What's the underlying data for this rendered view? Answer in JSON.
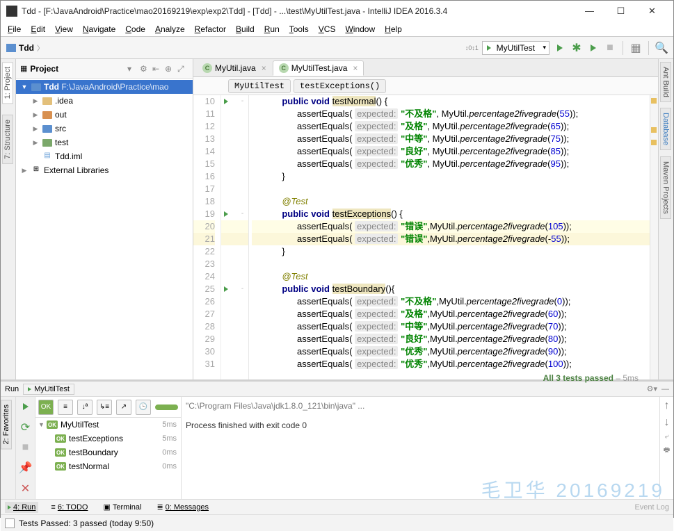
{
  "window": {
    "title": "Tdd - [F:\\JavaAndroid\\Practice\\mao20169219\\exp\\exp2\\Tdd] - [Tdd] - ...\\test\\MyUtilTest.java - IntelliJ IDEA 2016.3.4"
  },
  "menu": {
    "items": [
      "File",
      "Edit",
      "View",
      "Navigate",
      "Code",
      "Analyze",
      "Refactor",
      "Build",
      "Run",
      "Tools",
      "VCS",
      "Window",
      "Help"
    ]
  },
  "toolbar": {
    "breadcrumb": "Tdd",
    "run_config": "MyUtilTest"
  },
  "left_tabs": {
    "project": "1: Project",
    "structure": "7: Structure"
  },
  "right_tabs": {
    "ant": "Ant Build",
    "db": "Database",
    "maven": "Maven Projects"
  },
  "project": {
    "title": "Project",
    "root": {
      "name": "Tdd",
      "path": "F:\\JavaAndroid\\Practice\\mao"
    },
    "children": [
      {
        "name": ".idea",
        "color": ""
      },
      {
        "name": "out",
        "color": "orange"
      },
      {
        "name": "src",
        "color": "blue"
      },
      {
        "name": "test",
        "color": "green"
      },
      {
        "name": "Tdd.iml",
        "file": true
      }
    ],
    "ext_libs": "External Libraries"
  },
  "tabs": [
    {
      "label": "MyUtil.java",
      "active": false
    },
    {
      "label": "MyUtilTest.java",
      "active": true
    }
  ],
  "crumbs": {
    "class": "MyUtilTest",
    "method": "testExceptions()"
  },
  "code_lines": [
    {
      "n": 10,
      "run": true,
      "fold": "-",
      "ind": 2,
      "tok": [
        [
          "kw",
          "public"
        ],
        [
          "sp",
          " "
        ],
        [
          "kw",
          "void"
        ],
        [
          "sp",
          " "
        ],
        [
          "mname",
          "testNormal"
        ],
        [
          "p",
          "() {"
        ]
      ]
    },
    {
      "n": 11,
      "ind": 3,
      "tok": [
        [
          "id",
          "assertEquals"
        ],
        [
          "p",
          "( "
        ],
        [
          "hint",
          "expected:"
        ],
        [
          "sp",
          " "
        ],
        [
          "str",
          "\"不及格\""
        ],
        [
          "p",
          ", MyUtil."
        ],
        [
          "meth",
          "percentage2fivegrade"
        ],
        [
          "p",
          "("
        ],
        [
          "num",
          "55"
        ],
        [
          "p",
          "));"
        ]
      ]
    },
    {
      "n": 12,
      "ind": 3,
      "tok": [
        [
          "id",
          "assertEquals"
        ],
        [
          "p",
          "( "
        ],
        [
          "hint",
          "expected:"
        ],
        [
          "sp",
          " "
        ],
        [
          "str",
          "\"及格\""
        ],
        [
          "p",
          ", MyUtil."
        ],
        [
          "meth",
          "percentage2fivegrade"
        ],
        [
          "p",
          "("
        ],
        [
          "num",
          "65"
        ],
        [
          "p",
          "));"
        ]
      ]
    },
    {
      "n": 13,
      "ind": 3,
      "tok": [
        [
          "id",
          "assertEquals"
        ],
        [
          "p",
          "( "
        ],
        [
          "hint",
          "expected:"
        ],
        [
          "sp",
          " "
        ],
        [
          "str",
          "\"中等\""
        ],
        [
          "p",
          ", MyUtil."
        ],
        [
          "meth",
          "percentage2fivegrade"
        ],
        [
          "p",
          "("
        ],
        [
          "num",
          "75"
        ],
        [
          "p",
          "));"
        ]
      ]
    },
    {
      "n": 14,
      "ind": 3,
      "tok": [
        [
          "id",
          "assertEquals"
        ],
        [
          "p",
          "( "
        ],
        [
          "hint",
          "expected:"
        ],
        [
          "sp",
          " "
        ],
        [
          "str",
          "\"良好\""
        ],
        [
          "p",
          ", MyUtil."
        ],
        [
          "meth",
          "percentage2fivegrade"
        ],
        [
          "p",
          "("
        ],
        [
          "num",
          "85"
        ],
        [
          "p",
          "));"
        ]
      ]
    },
    {
      "n": 15,
      "ind": 3,
      "tok": [
        [
          "id",
          "assertEquals"
        ],
        [
          "p",
          "( "
        ],
        [
          "hint",
          "expected:"
        ],
        [
          "sp",
          " "
        ],
        [
          "str",
          "\"优秀\""
        ],
        [
          "p",
          ", MyUtil."
        ],
        [
          "meth",
          "percentage2fivegrade"
        ],
        [
          "p",
          "("
        ],
        [
          "num",
          "95"
        ],
        [
          "p",
          "));"
        ]
      ]
    },
    {
      "n": 16,
      "ind": 2,
      "tok": [
        [
          "p",
          "}"
        ]
      ]
    },
    {
      "n": 17,
      "ind": 0,
      "tok": []
    },
    {
      "n": 18,
      "ind": 2,
      "tok": [
        [
          "ann",
          "@Test"
        ]
      ]
    },
    {
      "n": 19,
      "run": true,
      "fold": "-",
      "ind": 2,
      "tok": [
        [
          "kw",
          "public"
        ],
        [
          "sp",
          " "
        ],
        [
          "kw",
          "void"
        ],
        [
          "sp",
          " "
        ],
        [
          "mname",
          "testExceptions"
        ],
        [
          "p",
          "() {"
        ]
      ]
    },
    {
      "n": 20,
      "hl": true,
      "ind": 3,
      "tok": [
        [
          "id",
          "assertEquals"
        ],
        [
          "p",
          "( "
        ],
        [
          "hint",
          "expected:"
        ],
        [
          "sp",
          " "
        ],
        [
          "str",
          "\"错误\""
        ],
        [
          "p",
          ",MyUtil."
        ],
        [
          "meth",
          "percentage2fivegrade"
        ],
        [
          "p",
          "("
        ],
        [
          "num",
          "105"
        ],
        [
          "p",
          "));"
        ]
      ]
    },
    {
      "n": 21,
      "sel": true,
      "ind": 3,
      "tok": [
        [
          "id",
          "assertEquals"
        ],
        [
          "p",
          "( "
        ],
        [
          "hint",
          "expected:"
        ],
        [
          "sp",
          " "
        ],
        [
          "str",
          "\"错误\""
        ],
        [
          "p",
          ",MyUtil."
        ],
        [
          "meth",
          "percentage2fivegrade"
        ],
        [
          "p",
          "(-"
        ],
        [
          "num",
          "55"
        ],
        [
          "p",
          "));"
        ]
      ]
    },
    {
      "n": 22,
      "ind": 2,
      "tok": [
        [
          "p",
          "}"
        ]
      ]
    },
    {
      "n": 23,
      "ind": 0,
      "tok": []
    },
    {
      "n": 24,
      "ind": 2,
      "tok": [
        [
          "ann",
          "@Test"
        ]
      ]
    },
    {
      "n": 25,
      "run": true,
      "fold": "-",
      "ind": 2,
      "tok": [
        [
          "kw",
          "public"
        ],
        [
          "sp",
          " "
        ],
        [
          "kw",
          "void"
        ],
        [
          "sp",
          " "
        ],
        [
          "mname",
          "testBoundary"
        ],
        [
          "p",
          "(){"
        ]
      ]
    },
    {
      "n": 26,
      "ind": 3,
      "tok": [
        [
          "id",
          "assertEquals"
        ],
        [
          "p",
          "( "
        ],
        [
          "hint",
          "expected:"
        ],
        [
          "sp",
          " "
        ],
        [
          "str",
          "\"不及格\""
        ],
        [
          "p",
          ",MyUtil."
        ],
        [
          "meth",
          "percentage2fivegrade"
        ],
        [
          "p",
          "("
        ],
        [
          "num",
          "0"
        ],
        [
          "p",
          "));"
        ]
      ]
    },
    {
      "n": 27,
      "ind": 3,
      "tok": [
        [
          "id",
          "assertEquals"
        ],
        [
          "p",
          "( "
        ],
        [
          "hint",
          "expected:"
        ],
        [
          "sp",
          " "
        ],
        [
          "str",
          "\"及格\""
        ],
        [
          "p",
          ",MyUtil."
        ],
        [
          "meth",
          "percentage2fivegrade"
        ],
        [
          "p",
          "("
        ],
        [
          "num",
          "60"
        ],
        [
          "p",
          "));"
        ]
      ]
    },
    {
      "n": 28,
      "ind": 3,
      "tok": [
        [
          "id",
          "assertEquals"
        ],
        [
          "p",
          "( "
        ],
        [
          "hint",
          "expected:"
        ],
        [
          "sp",
          " "
        ],
        [
          "str",
          "\"中等\""
        ],
        [
          "p",
          ",MyUtil."
        ],
        [
          "meth",
          "percentage2fivegrade"
        ],
        [
          "p",
          "("
        ],
        [
          "num",
          "70"
        ],
        [
          "p",
          "));"
        ]
      ]
    },
    {
      "n": 29,
      "ind": 3,
      "tok": [
        [
          "id",
          "assertEquals"
        ],
        [
          "p",
          "( "
        ],
        [
          "hint",
          "expected:"
        ],
        [
          "sp",
          " "
        ],
        [
          "str",
          "\"良好\""
        ],
        [
          "p",
          ",MyUtil."
        ],
        [
          "meth",
          "percentage2fivegrade"
        ],
        [
          "p",
          "("
        ],
        [
          "num",
          "80"
        ],
        [
          "p",
          "));"
        ]
      ]
    },
    {
      "n": 30,
      "ind": 3,
      "tok": [
        [
          "id",
          "assertEquals"
        ],
        [
          "p",
          "( "
        ],
        [
          "hint",
          "expected:"
        ],
        [
          "sp",
          " "
        ],
        [
          "str",
          "\"优秀\""
        ],
        [
          "p",
          ",MyUtil."
        ],
        [
          "meth",
          "percentage2fivegrade"
        ],
        [
          "p",
          "("
        ],
        [
          "num",
          "90"
        ],
        [
          "p",
          "));"
        ]
      ]
    },
    {
      "n": 31,
      "ind": 3,
      "tok": [
        [
          "id",
          "assertEquals"
        ],
        [
          "p",
          "( "
        ],
        [
          "hint",
          "expected:"
        ],
        [
          "sp",
          " "
        ],
        [
          "str",
          "\"优秀\""
        ],
        [
          "p",
          ",MyUtil."
        ],
        [
          "meth",
          "percentage2fivegrade"
        ],
        [
          "p",
          "("
        ],
        [
          "num",
          "100"
        ],
        [
          "p",
          "));"
        ]
      ]
    }
  ],
  "run": {
    "header_tab": "MyUtilTest",
    "header_label": "Run",
    "status": {
      "label": "All 3 tests passed",
      "time": "– 5ms"
    },
    "tree": {
      "root": {
        "name": "MyUtilTest",
        "time": "5ms"
      },
      "children": [
        {
          "name": "testExceptions",
          "time": "5ms"
        },
        {
          "name": "testBoundary",
          "time": "0ms"
        },
        {
          "name": "testNormal",
          "time": "0ms"
        }
      ]
    },
    "console": {
      "line1": "\"C:\\Program Files\\Java\\jdk1.8.0_121\\bin\\java\" ...",
      "line2": "Process finished with exit code 0"
    }
  },
  "bottom_tabs": {
    "run": "4: Run",
    "todo": "6: TODO",
    "terminal": "Terminal",
    "messages": "0: Messages"
  },
  "statusbar": {
    "text": "Tests Passed: 3 passed (today 9:50)"
  },
  "fav_tab": "2: Favorites",
  "watermark": "毛卫华 20169219"
}
